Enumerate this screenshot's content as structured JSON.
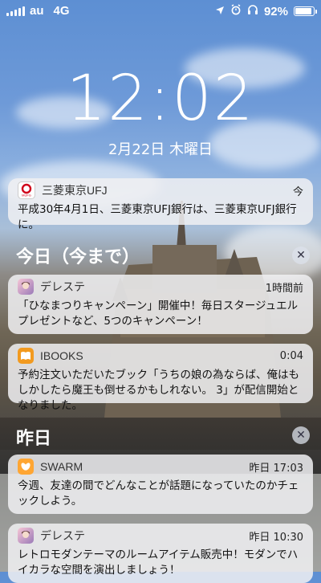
{
  "status": {
    "carrier": "au",
    "network": "4G",
    "battery_pct": "92%",
    "battery_level": 0.92
  },
  "lock": {
    "time": "12:02",
    "date": "2月22日 木曜日"
  },
  "notifications": [
    {
      "app": "三菱東京UFJ",
      "time": "今",
      "body": "平成30年4月1日、三菱東京UFJ銀行は、三菱東京UFJ銀行に。",
      "icon": "mufg-bank-icon"
    },
    {
      "app": "デレステ",
      "time": "1時間前",
      "body": "「ひなまつりキャンペーン」開催中！毎日スタージュエルプレゼントなど、5つのキャンペーン！",
      "icon": "deresute-app-icon"
    },
    {
      "app": "IBOOKS",
      "time": "0:04",
      "body": "予約注文いただいたブック「うちの娘の為ならば、俺はもしかしたら魔王も倒せるかもしれない。 3」が配信開始となりました。",
      "icon": "ibooks-icon"
    },
    {
      "app": "SWARM",
      "time": "昨日 17:03",
      "body": "今週、友達の間でどんなことが話題になっていたのかチェックしよう。",
      "icon": "swarm-icon"
    },
    {
      "app": "デレステ",
      "time": "昨日 10:30",
      "body": "レトロモダンテーマのルームアイテム販売中！モダンでハイカラな空間を演出しましょう！",
      "icon": "deresute-app-icon"
    }
  ],
  "sections": {
    "today": "今日（今まで）",
    "yesterday": "昨日"
  },
  "icon_labels": {
    "mufg": "MUFG"
  }
}
